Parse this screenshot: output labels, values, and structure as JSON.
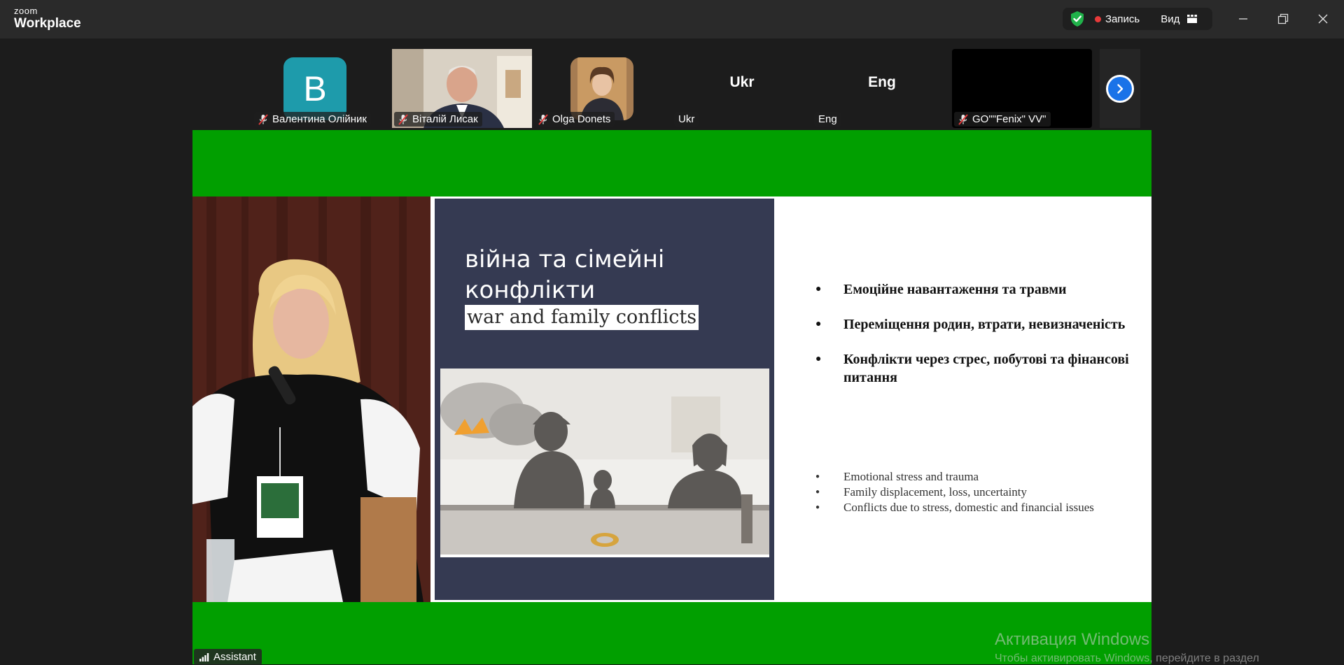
{
  "app": {
    "logo_top": "zoom",
    "logo_bottom": "Workplace"
  },
  "toolbar": {
    "record_label": "Запись",
    "view_label": "Вид"
  },
  "participants": [
    {
      "name": "Валентина Олійник",
      "initial": "B",
      "muted": true
    },
    {
      "name": "Віталій Лисак",
      "muted": true
    },
    {
      "name": "Olga Donets",
      "muted": true
    },
    {
      "name": "Ukr",
      "tile_text": "Ukr",
      "muted": false
    },
    {
      "name": "Eng",
      "tile_text": "Eng",
      "muted": false
    },
    {
      "name": "GO\"\"Fenix\" VV\"",
      "muted": true
    }
  ],
  "slide": {
    "title_uk": "війна та сімейні конфлікти",
    "title_en": "war and family conflicts",
    "bullets_uk": [
      "Емоційне навантаження та травми",
      "Переміщення родин, втрати, невизначеність",
      "Конфлікти через стрес, побутові та фінансові питання"
    ],
    "bullets_en": [
      "Emotional stress and trauma",
      "Family displacement, loss, uncertainty",
      "Conflicts due to stress, domestic and financial issues"
    ]
  },
  "active_speaker": {
    "name": "Assistant"
  },
  "watermark": {
    "line1": "Активация Windows",
    "line2": "Чтобы активировать Windows, перейдите в раздел"
  },
  "colors": {
    "share_bg": "#019f00",
    "slide_dark": "#353a52",
    "titlebar": "#2a2a2a",
    "accent": "#1a73e8"
  }
}
